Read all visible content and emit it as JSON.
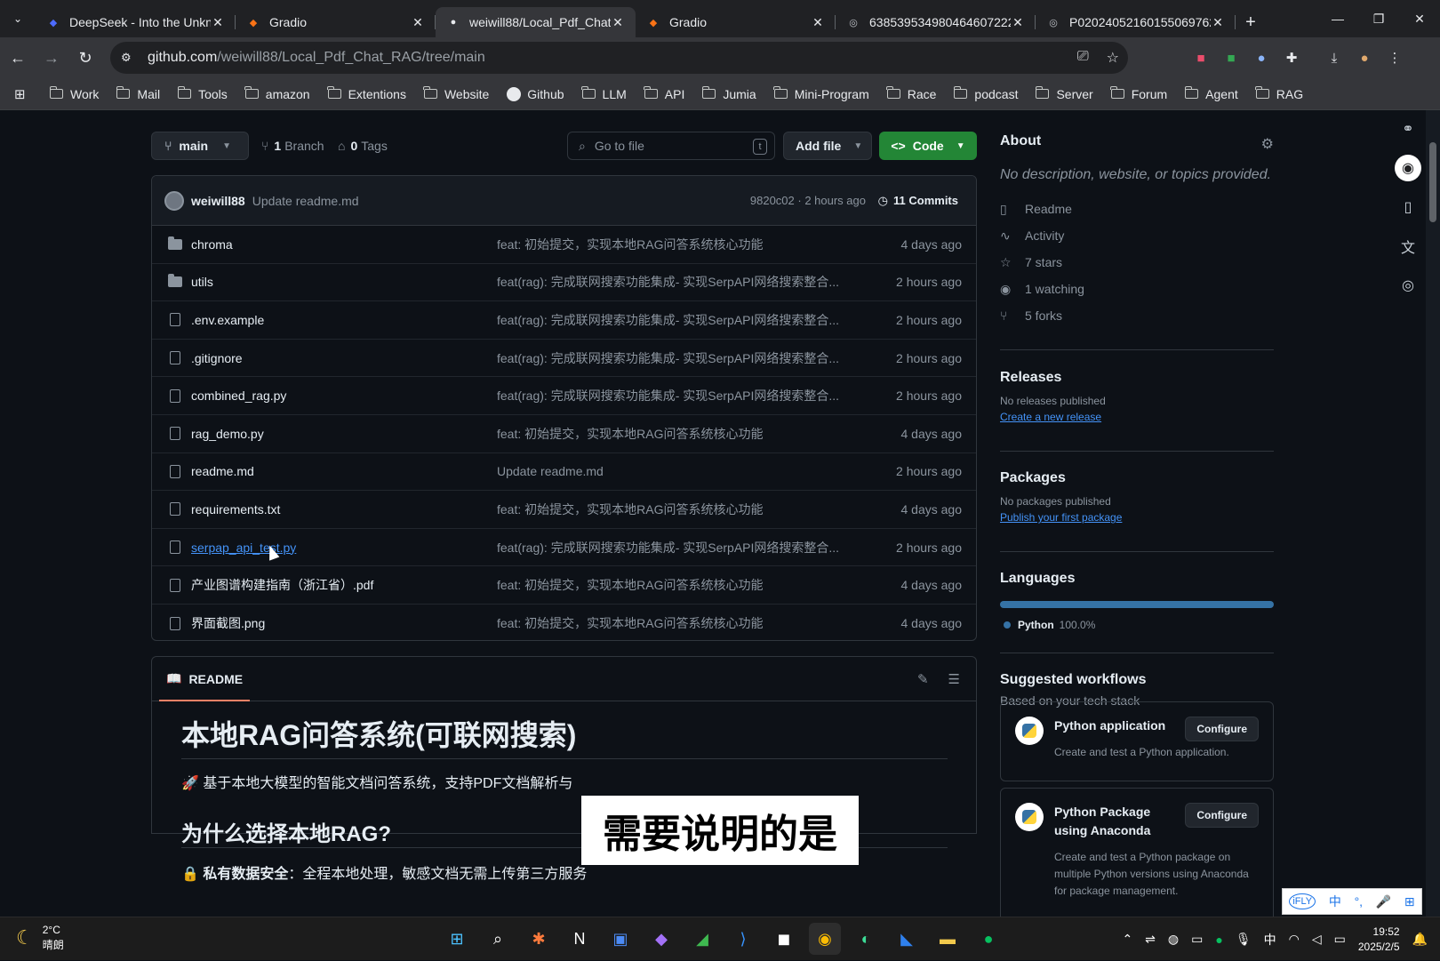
{
  "browser": {
    "tabs": [
      {
        "title": "DeepSeek - Into the Unkn",
        "fav": "deepseek-icon",
        "active": false
      },
      {
        "title": "Gradio",
        "fav": "gradio-icon",
        "active": false
      },
      {
        "title": "weiwill88/Local_Pdf_Chat",
        "fav": "github-icon",
        "active": true
      },
      {
        "title": "Gradio",
        "fav": "gradio-icon",
        "active": false
      },
      {
        "title": "638539534980464607222",
        "fav": "globe-icon",
        "active": false
      },
      {
        "title": "P020240521601550697621",
        "fav": "globe-icon",
        "active": false
      }
    ],
    "url_host": "github.com",
    "url_path": "/weiwill88/Local_Pdf_Chat_RAG/tree/main",
    "bookmarks": [
      "Work",
      "Mail",
      "Tools",
      "amazon",
      "Extentions",
      "Website",
      "Github",
      "LLM",
      "API",
      "Jumia",
      "Mini-Program",
      "Race",
      "podcast",
      "Server",
      "Forum",
      "Agent",
      "RAG"
    ]
  },
  "repo": {
    "branch": "main",
    "branches_count": "1",
    "branches_label": "Branch",
    "tags_count": "0",
    "tags_label": "Tags",
    "goto_placeholder": "Go to file",
    "goto_kbd": "t",
    "add_file": "Add file",
    "code": "Code",
    "last_commit": {
      "user": "weiwill88",
      "message": "Update readme.md",
      "hash_time": "9820c02 · 2 hours ago",
      "commits": "11 Commits"
    },
    "files": [
      {
        "name": "chroma",
        "type": "folder",
        "msg": "feat: 初始提交，实现本地RAG问答系统核心功能",
        "time": "4 days ago"
      },
      {
        "name": "utils",
        "type": "folder",
        "msg": "feat(rag): 完成联网搜索功能集成- 实现SerpAPI网络搜索整合...",
        "time": "2 hours ago"
      },
      {
        "name": ".env.example",
        "type": "file",
        "msg": "feat(rag): 完成联网搜索功能集成- 实现SerpAPI网络搜索整合...",
        "time": "2 hours ago"
      },
      {
        "name": ".gitignore",
        "type": "file",
        "msg": "feat(rag): 完成联网搜索功能集成- 实现SerpAPI网络搜索整合...",
        "time": "2 hours ago"
      },
      {
        "name": "combined_rag.py",
        "type": "file",
        "msg": "feat(rag): 完成联网搜索功能集成- 实现SerpAPI网络搜索整合...",
        "time": "2 hours ago"
      },
      {
        "name": "rag_demo.py",
        "type": "file",
        "msg": "feat: 初始提交，实现本地RAG问答系统核心功能",
        "time": "4 days ago"
      },
      {
        "name": "readme.md",
        "type": "file",
        "msg": "Update readme.md",
        "time": "2 hours ago"
      },
      {
        "name": "requirements.txt",
        "type": "file",
        "msg": "feat: 初始提交，实现本地RAG问答系统核心功能",
        "time": "4 days ago"
      },
      {
        "name": "serpap_api_test.py",
        "type": "file",
        "link": true,
        "msg": "feat(rag): 完成联网搜索功能集成- 实现SerpAPI网络搜索整合...",
        "time": "2 hours ago"
      },
      {
        "name": "产业图谱构建指南（浙江省）.pdf",
        "type": "file",
        "msg": "feat: 初始提交，实现本地RAG问答系统核心功能",
        "time": "4 days ago"
      },
      {
        "name": "界面截图.png",
        "type": "file",
        "msg": "feat: 初始提交，实现本地RAG问答系统核心功能",
        "time": "4 days ago"
      }
    ]
  },
  "readme": {
    "tab": "README",
    "h1": "本地RAG问答系统(可联网搜索)",
    "intro": "🚀 基于本地大模型的智能文档问答系统，支持PDF文档解析与",
    "h2": "为什么选择本地RAG?",
    "li_icon": "🔒",
    "li_bold": "私有数据安全",
    "li_rest": "：全程本地处理，敏感文档无需上传第三方服务"
  },
  "caption": "需要说明的是",
  "about": {
    "title": "About",
    "desc": "No description, website, or topics provided.",
    "items": [
      {
        "icon": "book-icon",
        "label": "Readme"
      },
      {
        "icon": "pulse-icon",
        "label": "Activity"
      },
      {
        "icon": "star-icon",
        "label": "7 stars"
      },
      {
        "icon": "eye-icon",
        "label": "1 watching"
      },
      {
        "icon": "fork-icon",
        "label": "5 forks"
      }
    ]
  },
  "releases": {
    "title": "Releases",
    "none": "No releases published",
    "link": "Create a new release"
  },
  "packages": {
    "title": "Packages",
    "none": "No packages published",
    "link": "Publish your first package"
  },
  "languages": {
    "title": "Languages",
    "name": "Python",
    "pct": "100.0%",
    "color": "#3572a5"
  },
  "workflows": {
    "title": "Suggested workflows",
    "sub": "Based on your tech stack",
    "cards": [
      {
        "title": "Python application",
        "desc": "Create and test a Python application.",
        "btn": "Configure"
      },
      {
        "title": "Python Package using Anaconda",
        "desc": "Create and test a Python package on multiple Python versions using Anaconda for package management.",
        "btn": "Configure"
      }
    ]
  },
  "ime": [
    "中",
    "°,",
    "🎤",
    "⊞"
  ],
  "taskbar": {
    "temp": "2°C",
    "weather": "晴朗",
    "time": "19:52",
    "date": "2025/2/5",
    "lang": "中"
  }
}
